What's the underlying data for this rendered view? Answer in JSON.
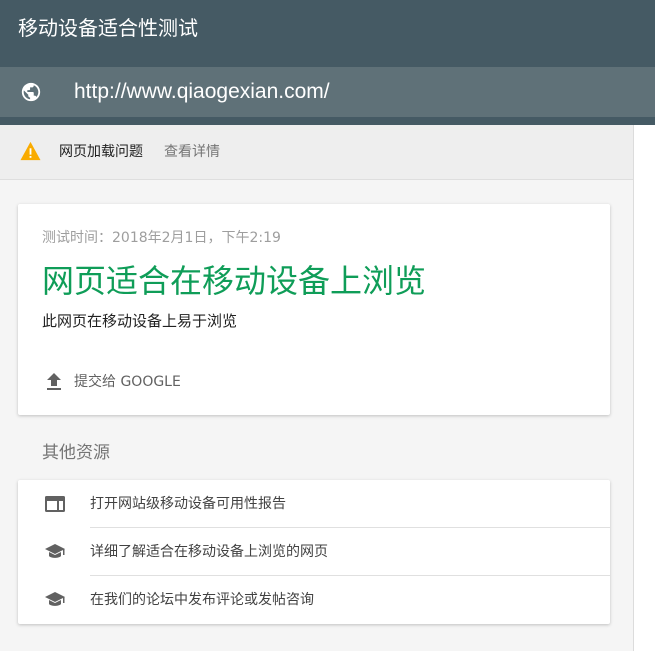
{
  "header": {
    "title": "移动设备适合性测试",
    "url": "http://www.qiaogexian.com/",
    "url_icon": "globe-icon"
  },
  "issue_bar": {
    "icon": "warning-icon",
    "label": "网页加载问题",
    "link": "查看详情"
  },
  "result": {
    "test_time": "测试时间：2018年2月1日，下午2:19",
    "title": "网页适合在移动设备上浏览",
    "subtitle": "此网页在移动设备上易于浏览",
    "submit_icon": "upload-icon",
    "submit_label": "提交给 GOOGLE"
  },
  "resources": {
    "title": "其他资源",
    "items": [
      {
        "icon": "web-window-icon",
        "label": "打开网站级移动设备可用性报告"
      },
      {
        "icon": "graduation-cap-icon",
        "label": "详细了解适合在移动设备上浏览的网页"
      },
      {
        "icon": "graduation-cap-icon",
        "label": "在我们的论坛中发布评论或发帖咨询"
      }
    ]
  },
  "colors": {
    "header_bg": "#455a64",
    "url_bar_bg": "#5f7178",
    "success_green": "#0f9d58",
    "warning_yellow": "#f9ab00"
  }
}
